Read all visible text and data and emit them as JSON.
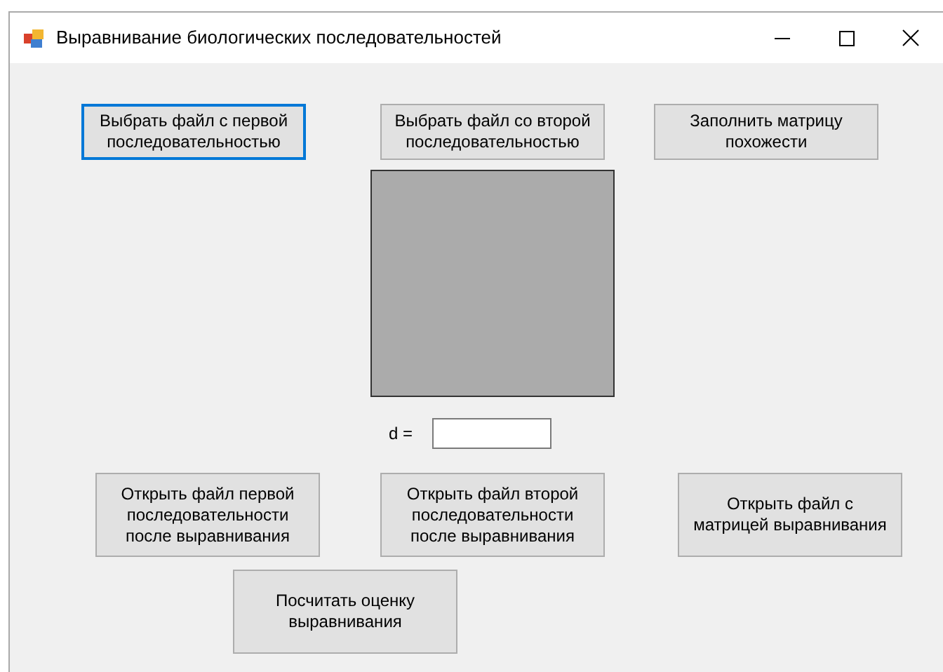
{
  "window": {
    "title": "Выравнивание биологических последовательностей"
  },
  "top_buttons": [
    {
      "lines": [
        "Выбрать файл с первой",
        "последовательностью"
      ],
      "focused": true
    },
    {
      "lines": [
        "Выбрать файл со второй",
        "последовательностью"
      ],
      "focused": false
    },
    {
      "lines": [
        "Заполнить матрицу",
        "похожести"
      ],
      "focused": false
    }
  ],
  "d_field": {
    "label": "d ="
  },
  "bottom_buttons": [
    {
      "lines": [
        "Открыть файл первой",
        "последовательности",
        "после выравнивания"
      ],
      "focused": false
    },
    {
      "lines": [
        "Открыть файл второй",
        "последовательности",
        "после выравнивания"
      ],
      "focused": false
    },
    {
      "lines": [
        "Открыть файл с",
        "матрицей выравнивания"
      ],
      "focused": false
    }
  ],
  "score_button": {
    "lines": [
      "Посчитать оценку",
      "выравнивания"
    ],
    "focused": false
  }
}
